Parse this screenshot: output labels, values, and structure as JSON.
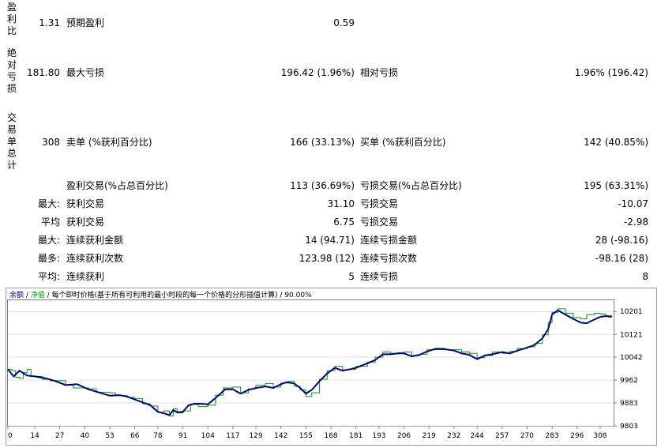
{
  "report": {
    "profit_ratio": {
      "label": "盈利比",
      "value": "1.31"
    },
    "expected_payoff": {
      "label": "预期盈利",
      "value": "0.59"
    },
    "absolute_drawdown": {
      "label": "绝对亏损",
      "value": "181.80"
    },
    "max_drawdown": {
      "label": "最大亏损",
      "value": "196.42 (1.96%)"
    },
    "relative_drawdown": {
      "label": "相对亏损",
      "value": "1.96% (196.42)"
    },
    "total_trades": {
      "label": "交易单总计",
      "value": "308"
    },
    "short_positions": {
      "label": "卖单 (%获利百分比)",
      "value": "166 (33.13%)"
    },
    "long_positions": {
      "label": "买单 (%获利百分比)",
      "value": "142 (40.85%)"
    },
    "profit_trades": {
      "label": "盈利交易(%占总百分比)",
      "value": "113 (36.69%)"
    },
    "loss_trades": {
      "label": "亏损交易(%占总百分比)",
      "value": "195 (63.31%)"
    },
    "rows": [
      {
        "prefix": "最大:",
        "l_label": "获利交易",
        "l_value": "31.10",
        "r_label": "亏损交易",
        "r_value": "-10.07"
      },
      {
        "prefix": "平均",
        "l_label": "获利交易",
        "l_value": "6.75",
        "r_label": "亏损交易",
        "r_value": "-2.98"
      },
      {
        "prefix": "最大:",
        "l_label": "连续获利金额",
        "l_value": "14 (94.71)",
        "r_label": "连续亏损金额",
        "r_value": "28 (-98.16)"
      },
      {
        "prefix": "最多:",
        "l_label": "连续获利次数",
        "l_value": "123.98 (12)",
        "r_label": "连续亏损次数",
        "r_value": "-98.16 (28)"
      },
      {
        "prefix": "平均:",
        "l_label": "连续获利",
        "l_value": "5",
        "r_label": "连续亏损",
        "r_value": "8"
      }
    ]
  },
  "chart_legend": {
    "balance": "余额",
    "sep1": " / ",
    "equity": "净值",
    "rest": " / 每个即时价格(基于所有可利用的最小时段的每一个价格的分形插值计算) / 90.00%"
  },
  "chart_data": {
    "type": "line",
    "series": [
      {
        "name": "余额",
        "color": "#00008b"
      },
      {
        "name": "净值",
        "color": "#00a000"
      }
    ],
    "ylim": [
      9803,
      10240
    ],
    "yticks": [
      "10201",
      "10121",
      "10042",
      "9962",
      "9883",
      "9803"
    ],
    "xlim": [
      0,
      315
    ],
    "xticks": [
      "0",
      "14",
      "27",
      "40",
      "53",
      "66",
      "78",
      "91",
      "104",
      "117",
      "129",
      "142",
      "155",
      "168",
      "181",
      "193",
      "206",
      "219",
      "232",
      "244",
      "257",
      "270",
      "283",
      "296",
      "308"
    ],
    "balance_points": [
      [
        0,
        10000
      ],
      [
        3,
        9975
      ],
      [
        6,
        9995
      ],
      [
        10,
        9978
      ],
      [
        14,
        9975
      ],
      [
        20,
        9968
      ],
      [
        25,
        9958
      ],
      [
        30,
        9945
      ],
      [
        36,
        9948
      ],
      [
        42,
        9930
      ],
      [
        48,
        9918
      ],
      [
        53,
        9908
      ],
      [
        58,
        9910
      ],
      [
        62,
        9905
      ],
      [
        66,
        9895
      ],
      [
        70,
        9885
      ],
      [
        74,
        9875
      ],
      [
        78,
        9852
      ],
      [
        82,
        9845
      ],
      [
        84,
        9840
      ],
      [
        86,
        9858
      ],
      [
        88,
        9850
      ],
      [
        91,
        9852
      ],
      [
        94,
        9875
      ],
      [
        97,
        9880
      ],
      [
        100,
        9880
      ],
      [
        104,
        9878
      ],
      [
        108,
        9900
      ],
      [
        113,
        9930
      ],
      [
        117,
        9930
      ],
      [
        121,
        9915
      ],
      [
        125,
        9928
      ],
      [
        129,
        9935
      ],
      [
        134,
        9940
      ],
      [
        138,
        9935
      ],
      [
        142,
        9948
      ],
      [
        145,
        9955
      ],
      [
        149,
        9950
      ],
      [
        152,
        9935
      ],
      [
        155,
        9915
      ],
      [
        158,
        9928
      ],
      [
        162,
        9958
      ],
      [
        166,
        9985
      ],
      [
        170,
        10005
      ],
      [
        174,
        9995
      ],
      [
        178,
        10000
      ],
      [
        181,
        10005
      ],
      [
        186,
        10018
      ],
      [
        191,
        10032
      ],
      [
        195,
        10052
      ],
      [
        199,
        10052
      ],
      [
        203,
        10055
      ],
      [
        206,
        10055
      ],
      [
        210,
        10045
      ],
      [
        214,
        10050
      ],
      [
        218,
        10062
      ],
      [
        222,
        10070
      ],
      [
        227,
        10070
      ],
      [
        232,
        10065
      ],
      [
        236,
        10055
      ],
      [
        240,
        10050
      ],
      [
        244,
        10035
      ],
      [
        248,
        10048
      ],
      [
        252,
        10052
      ],
      [
        257,
        10060
      ],
      [
        261,
        10055
      ],
      [
        265,
        10065
      ],
      [
        270,
        10075
      ],
      [
        274,
        10085
      ],
      [
        278,
        10108
      ],
      [
        281,
        10140
      ],
      [
        283,
        10190
      ],
      [
        286,
        10205
      ],
      [
        290,
        10190
      ],
      [
        294,
        10175
      ],
      [
        298,
        10162
      ],
      [
        301,
        10160
      ],
      [
        304,
        10170
      ],
      [
        308,
        10182
      ],
      [
        311,
        10185
      ],
      [
        314,
        10182
      ]
    ],
    "equity_points": [
      [
        0,
        10000
      ],
      [
        2,
        9995
      ],
      [
        4,
        9972
      ],
      [
        6,
        9968
      ],
      [
        8,
        9988
      ],
      [
        10,
        10000
      ],
      [
        12,
        9975
      ],
      [
        18,
        9965
      ],
      [
        22,
        9960
      ],
      [
        30,
        9945
      ],
      [
        34,
        9935
      ],
      [
        42,
        9932
      ],
      [
        46,
        9920
      ],
      [
        53,
        9918
      ],
      [
        56,
        9908
      ],
      [
        62,
        9902
      ],
      [
        66,
        9898
      ],
      [
        70,
        9880
      ],
      [
        74,
        9872
      ],
      [
        78,
        9850
      ],
      [
        81,
        9855
      ],
      [
        84,
        9838
      ],
      [
        86,
        9862
      ],
      [
        88,
        9848
      ],
      [
        91,
        9855
      ],
      [
        95,
        9878
      ],
      [
        99,
        9870
      ],
      [
        104,
        9875
      ],
      [
        108,
        9910
      ],
      [
        112,
        9935
      ],
      [
        117,
        9938
      ],
      [
        121,
        9918
      ],
      [
        125,
        9932
      ],
      [
        129,
        9945
      ],
      [
        134,
        9950
      ],
      [
        138,
        9938
      ],
      [
        142,
        9952
      ],
      [
        146,
        9958
      ],
      [
        149,
        9940
      ],
      [
        152,
        9928
      ],
      [
        155,
        9905
      ],
      [
        158,
        9918
      ],
      [
        162,
        9965
      ],
      [
        166,
        9995
      ],
      [
        170,
        10010
      ],
      [
        174,
        9998
      ],
      [
        178,
        10000
      ],
      [
        181,
        10010
      ],
      [
        187,
        10025
      ],
      [
        191,
        10042
      ],
      [
        195,
        10060
      ],
      [
        199,
        10055
      ],
      [
        203,
        10058
      ],
      [
        206,
        10060
      ],
      [
        210,
        10048
      ],
      [
        214,
        10052
      ],
      [
        218,
        10068
      ],
      [
        222,
        10073
      ],
      [
        227,
        10068
      ],
      [
        232,
        10068
      ],
      [
        236,
        10060
      ],
      [
        240,
        10055
      ],
      [
        244,
        10040
      ],
      [
        248,
        10048
      ],
      [
        252,
        10060
      ],
      [
        257,
        10055
      ],
      [
        261,
        10062
      ],
      [
        265,
        10072
      ],
      [
        270,
        10078
      ],
      [
        274,
        10090
      ],
      [
        278,
        10120
      ],
      [
        281,
        10162
      ],
      [
        283,
        10198
      ],
      [
        286,
        10210
      ],
      [
        290,
        10195
      ],
      [
        294,
        10180
      ],
      [
        298,
        10175
      ],
      [
        301,
        10190
      ],
      [
        305,
        10195
      ],
      [
        308,
        10192
      ],
      [
        311,
        10186
      ],
      [
        314,
        10182
      ]
    ]
  }
}
